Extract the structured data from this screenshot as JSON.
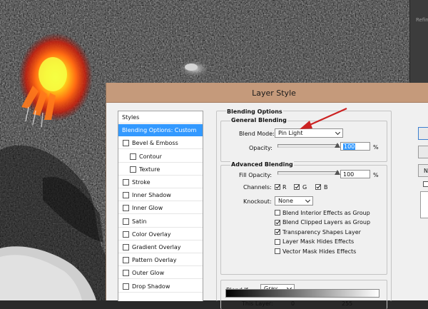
{
  "background": {
    "panel_text": "Refin"
  },
  "dialog": {
    "title": "Layer Style",
    "styles": [
      {
        "label": "Styles",
        "checkbox": false,
        "checked": false,
        "indent": 0,
        "selected": false
      },
      {
        "label": "Blending Options: Custom",
        "checkbox": false,
        "checked": false,
        "indent": 0,
        "selected": true
      },
      {
        "label": "Bevel & Emboss",
        "checkbox": true,
        "checked": false,
        "indent": 0,
        "selected": false
      },
      {
        "label": "Contour",
        "checkbox": true,
        "checked": false,
        "indent": 1,
        "selected": false
      },
      {
        "label": "Texture",
        "checkbox": true,
        "checked": false,
        "indent": 1,
        "selected": false
      },
      {
        "label": "Stroke",
        "checkbox": true,
        "checked": false,
        "indent": 0,
        "selected": false
      },
      {
        "label": "Inner Shadow",
        "checkbox": true,
        "checked": false,
        "indent": 0,
        "selected": false
      },
      {
        "label": "Inner Glow",
        "checkbox": true,
        "checked": false,
        "indent": 0,
        "selected": false
      },
      {
        "label": "Satin",
        "checkbox": true,
        "checked": false,
        "indent": 0,
        "selected": false
      },
      {
        "label": "Color Overlay",
        "checkbox": true,
        "checked": false,
        "indent": 0,
        "selected": false
      },
      {
        "label": "Gradient Overlay",
        "checkbox": true,
        "checked": false,
        "indent": 0,
        "selected": false
      },
      {
        "label": "Pattern Overlay",
        "checkbox": true,
        "checked": false,
        "indent": 0,
        "selected": false
      },
      {
        "label": "Outer Glow",
        "checkbox": true,
        "checked": false,
        "indent": 0,
        "selected": false
      },
      {
        "label": "Drop Shadow",
        "checkbox": true,
        "checked": false,
        "indent": 0,
        "selected": false
      }
    ],
    "blending": {
      "section_title": "Blending Options",
      "general_title": "General Blending",
      "blend_mode_label": "Blend Mode:",
      "blend_mode_value": "Pin Light",
      "opacity_label": "Opacity:",
      "opacity_value": "100",
      "opacity_unit": "%",
      "opacity_level": 1.0,
      "advanced_title": "Advanced Blending",
      "fill_opacity_label": "Fill Opacity:",
      "fill_opacity_value": "100",
      "fill_opacity_unit": "%",
      "fill_opacity_level": 1.0,
      "channels_label": "Channels:",
      "channel_r": "R",
      "channel_g": "G",
      "channel_b": "B",
      "knockout_label": "Knockout:",
      "knockout_value": "None",
      "options": [
        {
          "label": "Blend Interior Effects as Group",
          "checked": false
        },
        {
          "label": "Blend Clipped Layers as Group",
          "checked": true
        },
        {
          "label": "Transparency Shapes Layer",
          "checked": true
        },
        {
          "label": "Layer Mask Hides Effects",
          "checked": false
        },
        {
          "label": "Vector Mask Hides Effects",
          "checked": false
        }
      ],
      "blend_if_label": "Blend If:",
      "blend_if_value": "Gray",
      "this_layer_label": "This Layer:",
      "this_layer_min": "0",
      "this_layer_max": "255"
    },
    "right_buttons": {
      "partial_label": "N"
    }
  },
  "colors": {
    "titlebar": "#c59a7b",
    "selection": "#3399ff",
    "arrow": "#cc2222"
  },
  "icons": [
    "chevron-down-icon",
    "checkbox-icon",
    "slider-thumb-icon",
    "red-arrow-annotation-icon"
  ]
}
